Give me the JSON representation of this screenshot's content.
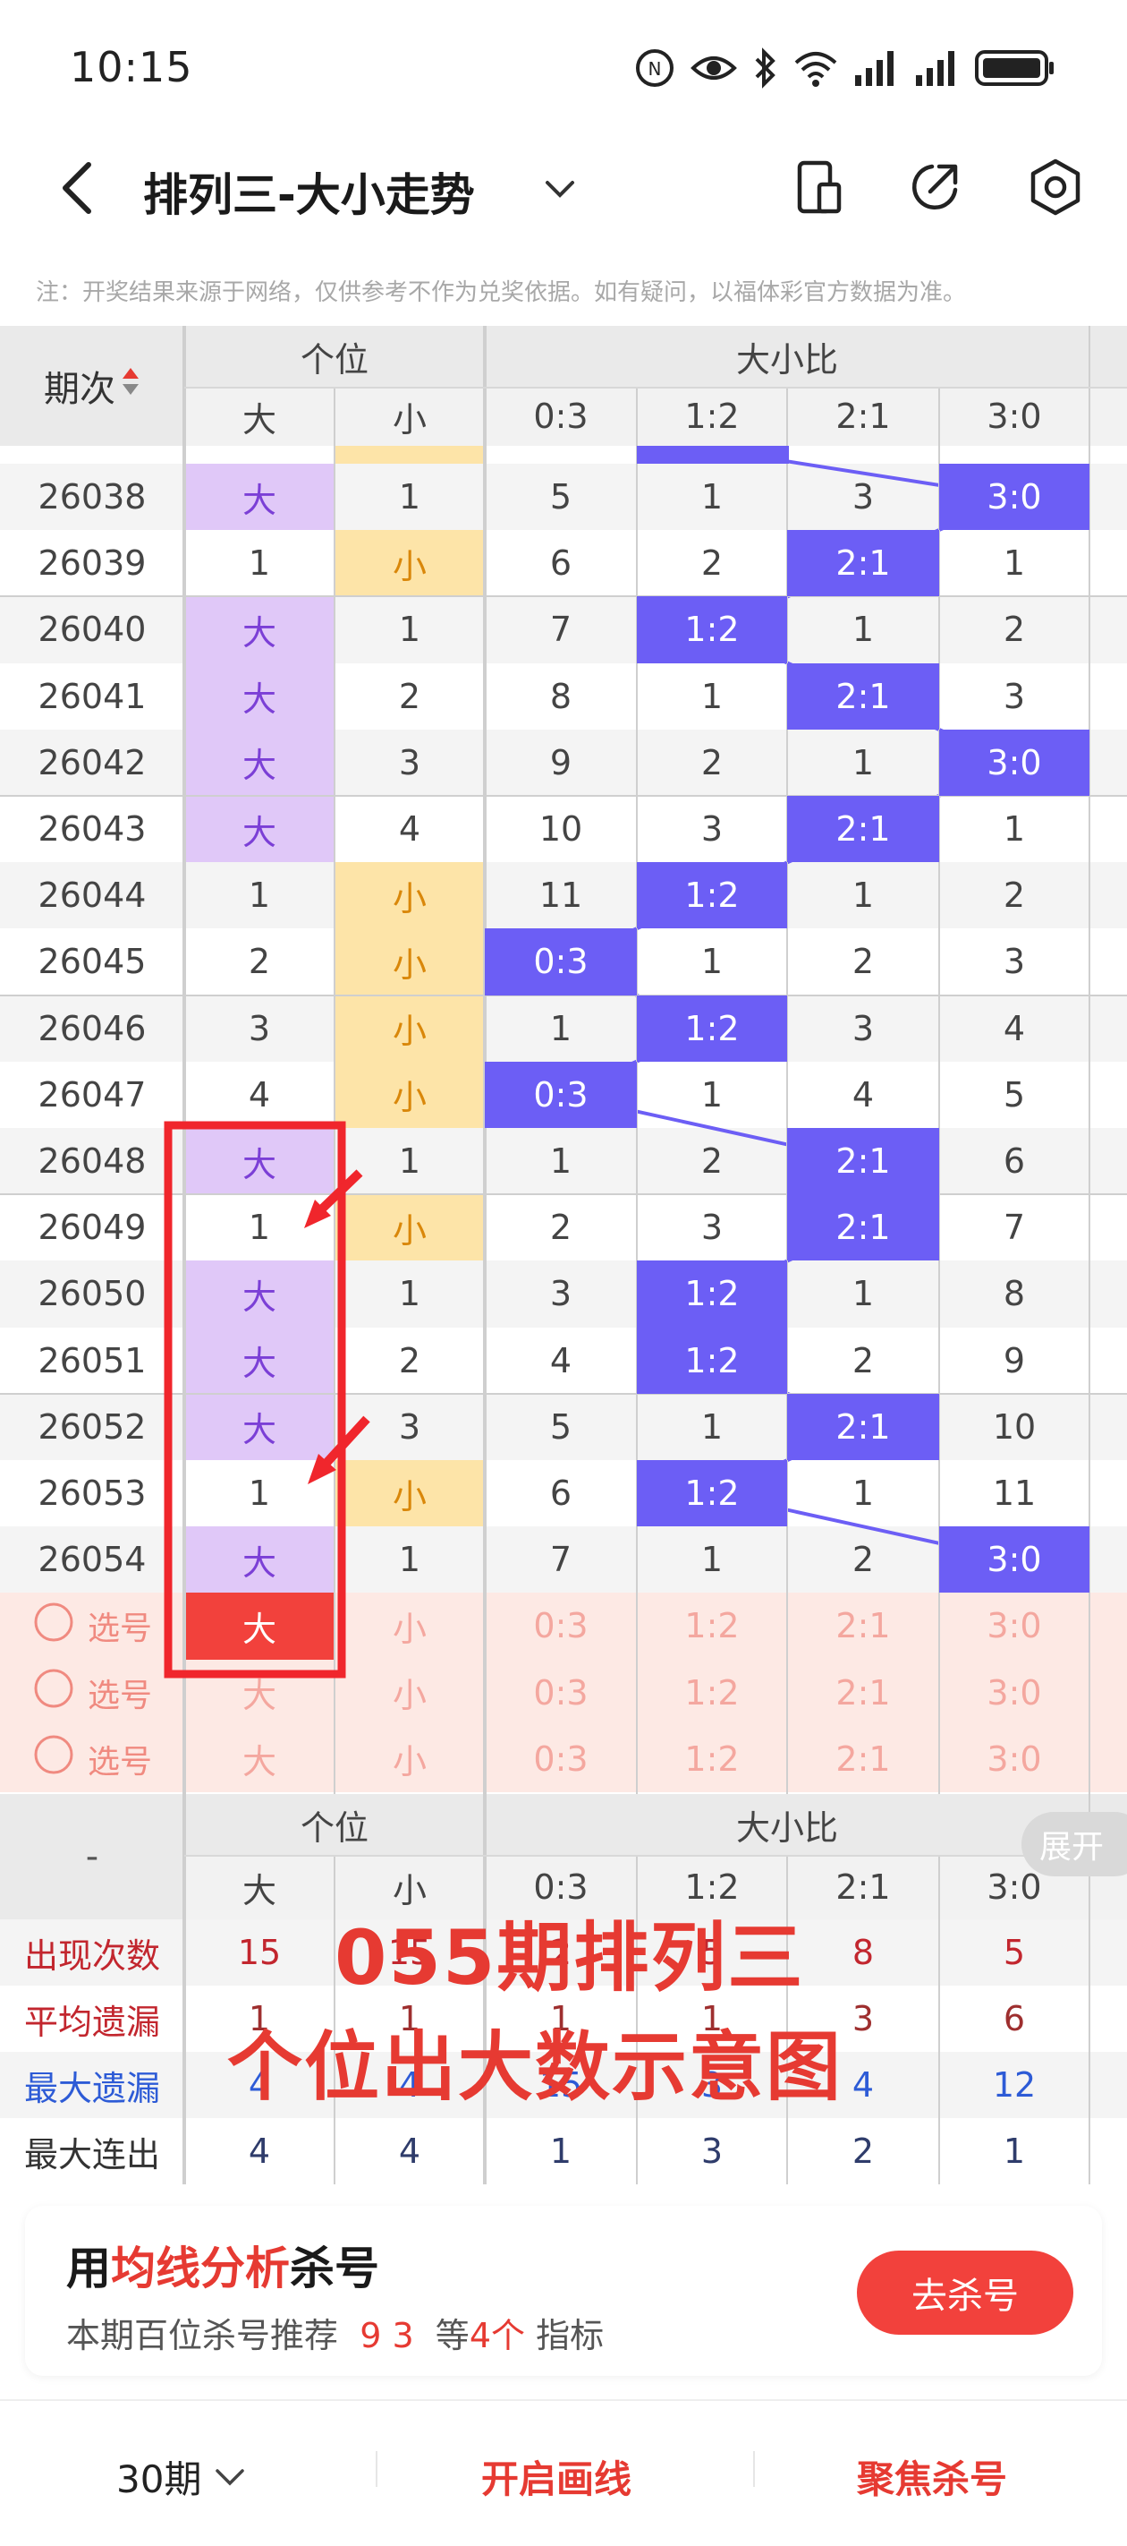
{
  "status_bar": {
    "time": "10:15"
  },
  "header": {
    "title": "排列三-大小走势"
  },
  "notice": "注：开奖结果来源于网络，仅供参考不作为兑奖依据。如有疑问，以福体彩官方数据为准。",
  "table": {
    "period_header": "期次",
    "group_geiwei": "个位",
    "group_ratio": "大小比",
    "sub_headers": [
      "大",
      "小",
      "0:3",
      "1:2",
      "2:1",
      "3:0"
    ],
    "rows": [
      {
        "period": "26038",
        "cells": [
          "大",
          "1",
          "5",
          "1",
          "3",
          "3:0"
        ]
      },
      {
        "period": "26039",
        "cells": [
          "1",
          "小",
          "6",
          "2",
          "2:1",
          "1"
        ]
      },
      {
        "period": "26040",
        "cells": [
          "大",
          "1",
          "7",
          "1:2",
          "1",
          "2"
        ]
      },
      {
        "period": "26041",
        "cells": [
          "大",
          "2",
          "8",
          "1",
          "2:1",
          "3"
        ]
      },
      {
        "period": "26042",
        "cells": [
          "大",
          "3",
          "9",
          "2",
          "1",
          "3:0"
        ]
      },
      {
        "period": "26043",
        "cells": [
          "大",
          "4",
          "10",
          "3",
          "2:1",
          "1"
        ]
      },
      {
        "period": "26044",
        "cells": [
          "1",
          "小",
          "11",
          "1:2",
          "1",
          "2"
        ]
      },
      {
        "period": "26045",
        "cells": [
          "2",
          "小",
          "0:3",
          "1",
          "2",
          "3"
        ]
      },
      {
        "period": "26046",
        "cells": [
          "3",
          "小",
          "1",
          "1:2",
          "3",
          "4"
        ]
      },
      {
        "period": "26047",
        "cells": [
          "4",
          "小",
          "0:3",
          "1",
          "4",
          "5"
        ]
      },
      {
        "period": "26048",
        "cells": [
          "大",
          "1",
          "1",
          "2",
          "2:1",
          "6"
        ]
      },
      {
        "period": "26049",
        "cells": [
          "1",
          "小",
          "2",
          "3",
          "2:1",
          "7"
        ]
      },
      {
        "period": "26050",
        "cells": [
          "大",
          "1",
          "3",
          "1:2",
          "1",
          "8"
        ]
      },
      {
        "period": "26051",
        "cells": [
          "大",
          "2",
          "4",
          "1:2",
          "2",
          "9"
        ]
      },
      {
        "period": "26052",
        "cells": [
          "大",
          "3",
          "5",
          "1",
          "2:1",
          "10"
        ]
      },
      {
        "period": "26053",
        "cells": [
          "1",
          "小",
          "6",
          "1:2",
          "1",
          "11"
        ]
      },
      {
        "period": "26054",
        "cells": [
          "大",
          "1",
          "7",
          "1",
          "2",
          "3:0"
        ]
      }
    ],
    "select_label": "选号",
    "select_cells": [
      "大",
      "小",
      "0:3",
      "1:2",
      "2:1",
      "3:0"
    ]
  },
  "summary": {
    "dash": "-",
    "expand_label": "展开",
    "rows": [
      {
        "label": "出现次数",
        "values": [
          "15",
          "15",
          "2",
          "5",
          "8",
          "5"
        ]
      },
      {
        "label": "平均遗漏",
        "values": [
          "1",
          "1",
          "1",
          "1",
          "3",
          "6"
        ]
      },
      {
        "label": "最大遗漏",
        "values": [
          "4",
          "4",
          "15",
          "3",
          "4",
          "12"
        ]
      },
      {
        "label": "最大连出",
        "values": [
          "4",
          "4",
          "1",
          "3",
          "2",
          "1"
        ]
      }
    ]
  },
  "overlay": {
    "line1": "055期排列三",
    "line2": "个位出大数示意图"
  },
  "promo": {
    "title_pre": "用",
    "title_highlight": "均线分析",
    "title_post": "杀号",
    "sub_pre": "本期百位杀号推荐",
    "sub_nums": "9 3",
    "sub_mid": "等",
    "sub_count": "4个",
    "sub_post": "指标",
    "button": "去杀号"
  },
  "bottom_bar": {
    "period_select": "30期",
    "draw_line": "开启画线",
    "focus_kill": "聚焦杀号"
  },
  "colors": {
    "big_bg": "#e0c8f8",
    "big_text": "#7b3fd6",
    "small_bg": "#fde4a8",
    "small_text": "#d9870a",
    "ratio_bg": "#6c5ef5",
    "red": "#e63a32",
    "select_bg": "#fde9e4"
  }
}
